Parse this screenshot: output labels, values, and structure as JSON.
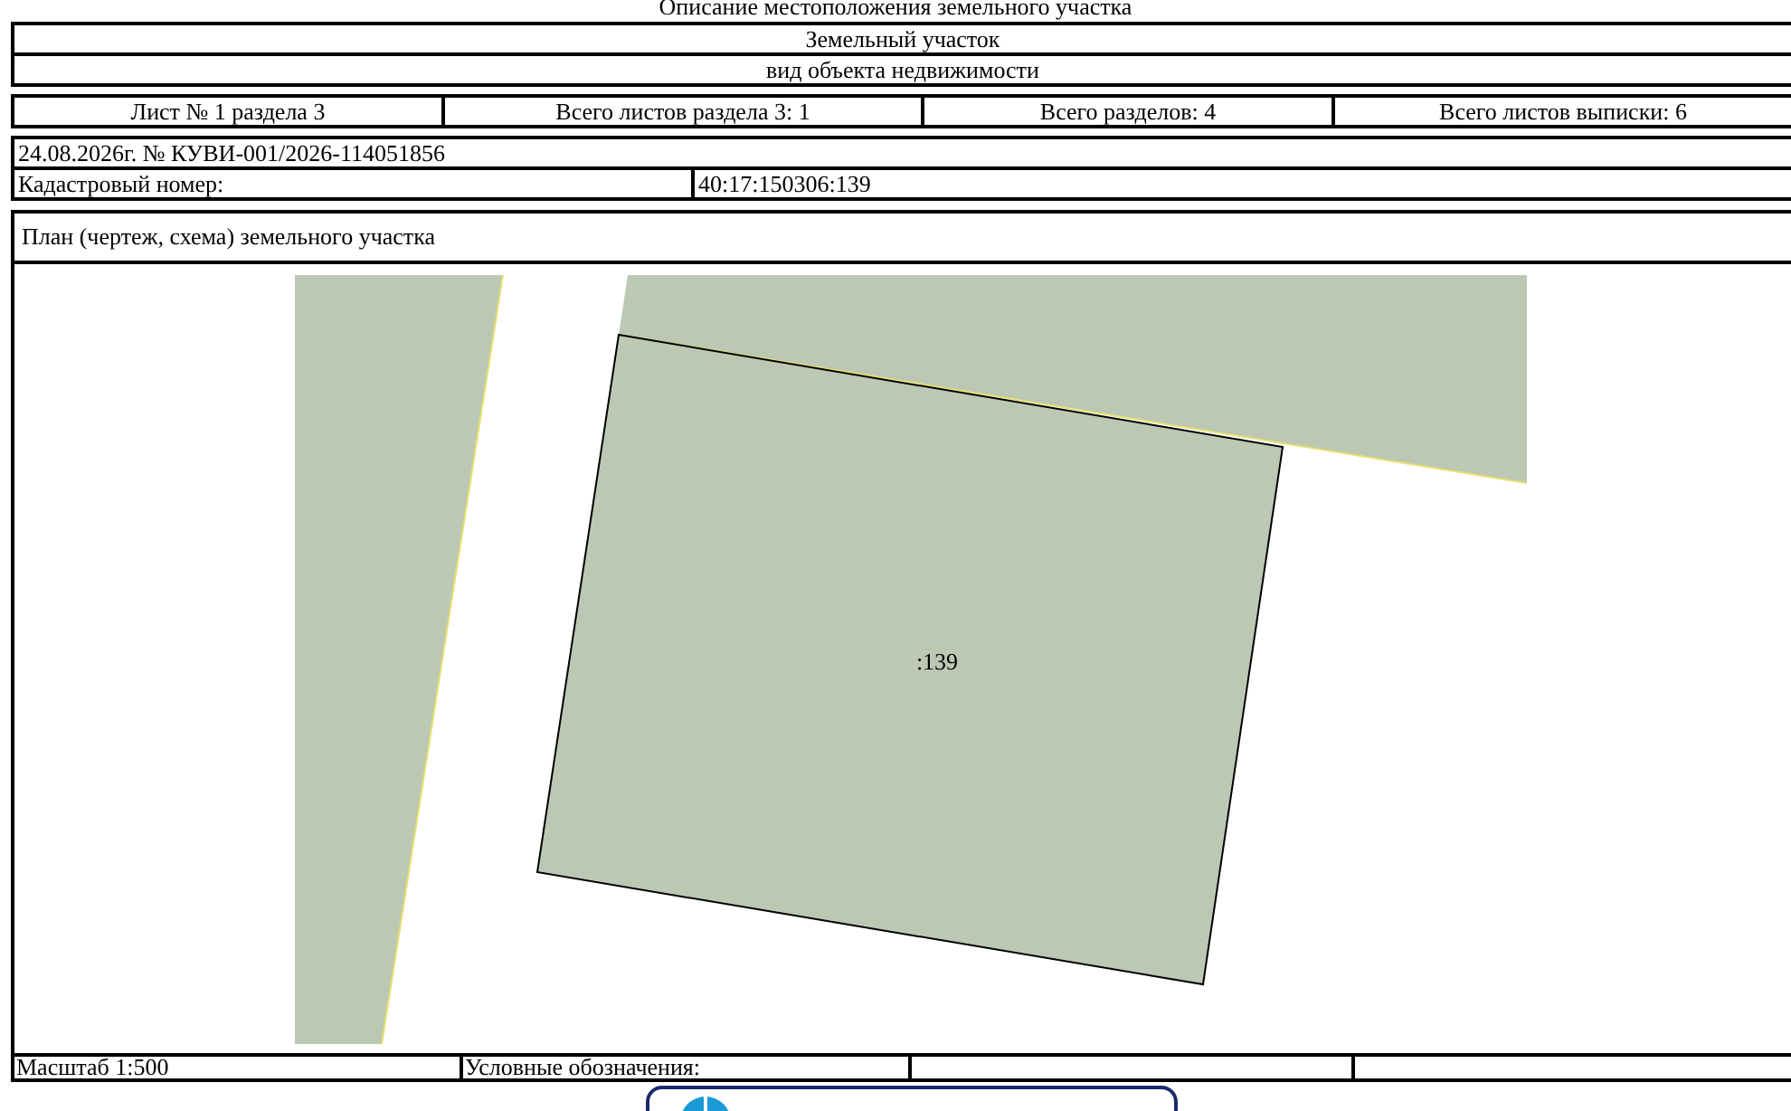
{
  "document_title": "Описание местоположения земельного участка",
  "header": {
    "object": "Земельный участок",
    "object_type": "вид объекта недвижимости"
  },
  "sheet_info": [
    "Лист № 1 раздела 3",
    "Всего листов раздела 3: 1",
    "Всего разделов: 4",
    "Всего листов выписки: 6"
  ],
  "record": {
    "date_number": "24.08.2026г. № КУВИ-001/2026-114051856",
    "cadastral_label": "Кадастровый номер:",
    "cadastral_number": "40:17:150306:139"
  },
  "plan": {
    "title": "План (чертеж, схема) земельного участка",
    "parcel_label": ":139"
  },
  "footer": {
    "scale": "Масштаб 1:500",
    "legend": "Условные обозначения:"
  }
}
